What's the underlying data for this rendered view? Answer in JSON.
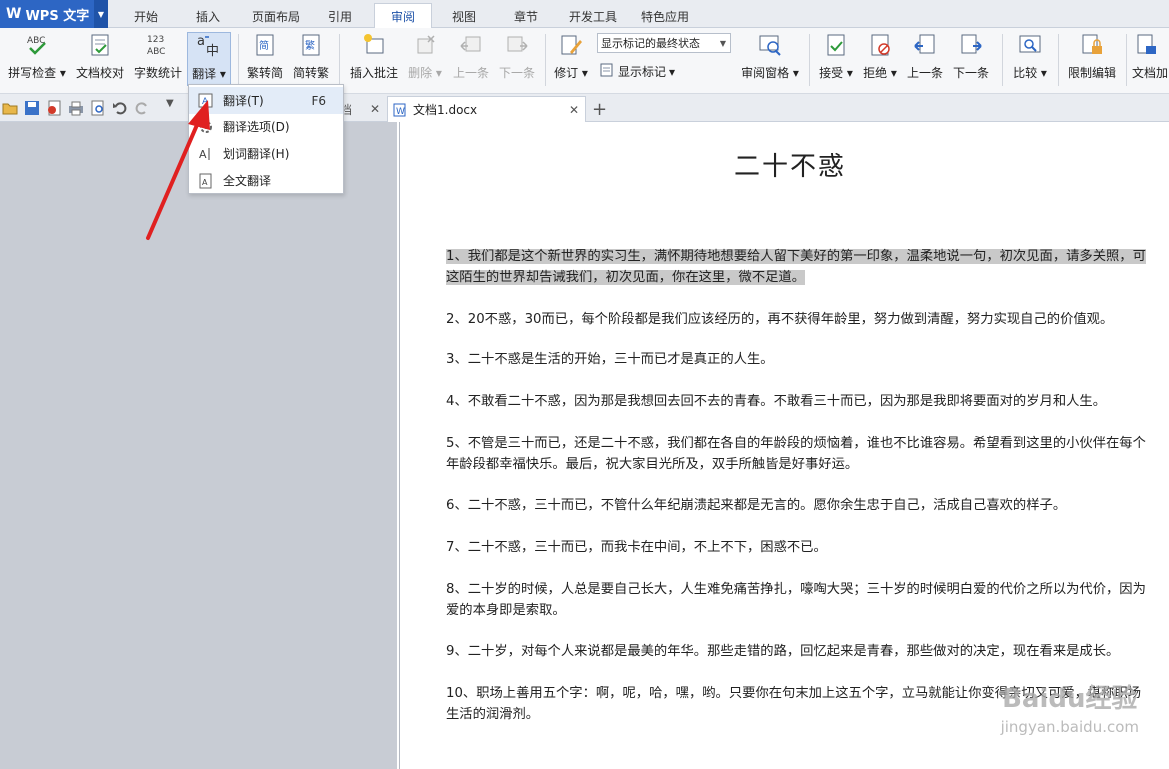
{
  "app": {
    "title": "WPS 文字"
  },
  "menu_tabs": [
    "开始",
    "插入",
    "页面布局",
    "引用",
    "审阅",
    "视图",
    "章节",
    "开发工具",
    "特色应用"
  ],
  "ribbon": {
    "spell_check": "拼写检查",
    "doc_proof": "文档校对",
    "word_count": "字数统计",
    "translate": "翻译",
    "trad_to_simp": "繁转简",
    "simp_to_trad": "简转繁",
    "insert_comment": "插入批注",
    "delete": "删除",
    "prev": "上一条",
    "next": "下一条",
    "revise": "修订",
    "markup_state": "显示标记的最终状态",
    "show_markup": "显示标记",
    "review_pane": "审阅窗格",
    "accept": "接受",
    "reject": "拒绝",
    "prev2": "上一条",
    "next2": "下一条",
    "compare": "比较",
    "restrict": "限制编辑",
    "doc_enc": "文档加"
  },
  "tabs": {
    "doc_tab": "文档1.docx",
    "add": "+"
  },
  "dropdown": {
    "items": [
      {
        "label": "翻译(T)",
        "shortcut": "F6"
      },
      {
        "label": "翻译选项(D)",
        "shortcut": ""
      },
      {
        "label": "划词翻译(H)",
        "shortcut": ""
      },
      {
        "label": "全文翻译",
        "shortcut": ""
      }
    ]
  },
  "document": {
    "title": "二十不惑",
    "paragraphs": [
      "1、我们都是这个新世界的实习生，满怀期待地想要给人留下美好的第一印象，温柔地说一句，初次见面，请多关照，可这陌生的世界却告诫我们，初次见面，你在这里，微不足道。",
      "2、20不惑，30而已，每个阶段都是我们应该经历的，再不获得年龄里，努力做到清醒，努力实现自己的价值观。",
      "3、二十不惑是生活的开始，三十而已才是真正的人生。",
      "4、不敢看二十不惑，因为那是我想回去回不去的青春。不敢看三十而已，因为那是我即将要面对的岁月和人生。",
      "5、不管是三十而已，还是二十不惑，我们都在各自的年龄段的烦恼着，谁也不比谁容易。希望看到这里的小伙伴在每个年龄段都幸福快乐。最后，祝大家目光所及，双手所触皆是好事好运。",
      "6、二十不惑，三十而已，不管什么年纪崩溃起来都是无言的。愿你余生忠于自己，活成自己喜欢的样子。",
      "7、二十不惑，三十而已，而我卡在中间，不上不下，困惑不已。",
      "8、二十岁的时候，人总是要自己长大，人生难免痛苦挣扎，嚎啕大哭；三十岁的时候明白爱的代价之所以为代价，因为爱的本身即是索取。",
      "9、二十岁，对每个人来说都是最美的年华。那些走错的路，回忆起来是青春，那些做对的决定，现在看来是成长。",
      "10、职场上善用五个字：啊，呢，哈，嘿，哟。只要你在句末加上这五个字，立马就能让你变得亲切又可爱，堪称职场生活的润滑剂。"
    ]
  },
  "watermark": {
    "main": "Baidu经验",
    "sub": "jingyan.baidu.com"
  }
}
